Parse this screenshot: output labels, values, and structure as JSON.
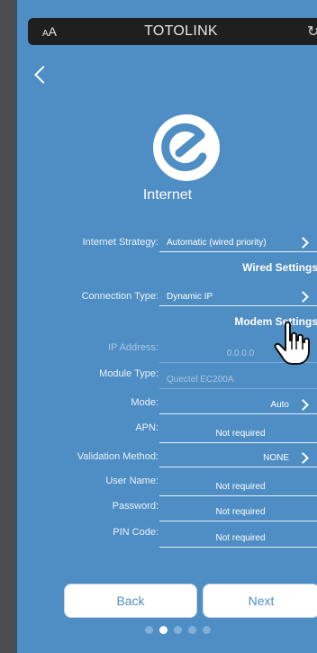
{
  "browser": {
    "aa_small": "A",
    "aa_big": "A",
    "site": "TOTOLINK",
    "reload_icon": "reload-icon"
  },
  "page": {
    "title": "Internet"
  },
  "internet": {
    "strategy_label": "Internet Strategy:",
    "strategy_value": "Automatic (wired priority)"
  },
  "wired": {
    "section": "Wired Settings",
    "connection_type_label": "Connection Type:",
    "connection_type_value": "Dynamic IP"
  },
  "modem": {
    "section": "Modem Settings",
    "ip_label": "IP Address:",
    "ip_value": "0.0.0.0",
    "module_label": "Module Type:",
    "module_value": "Quectel EC200A",
    "mode_label": "Mode:",
    "mode_value": "Auto",
    "apn_label": "APN:",
    "apn_value": "Not required",
    "validation_label": "Validation Method:",
    "validation_value": "NONE",
    "username_label": "User Name:",
    "username_value": "Not required",
    "password_label": "Password:",
    "password_value": "Not required",
    "pin_label": "PIN Code:",
    "pin_value": "Not required"
  },
  "buttons": {
    "back": "Back",
    "next": "Next"
  },
  "pagination": {
    "total": 5,
    "active_index": 1
  },
  "colors": {
    "background": "#4f8ec4",
    "accent": "#ffffff"
  }
}
